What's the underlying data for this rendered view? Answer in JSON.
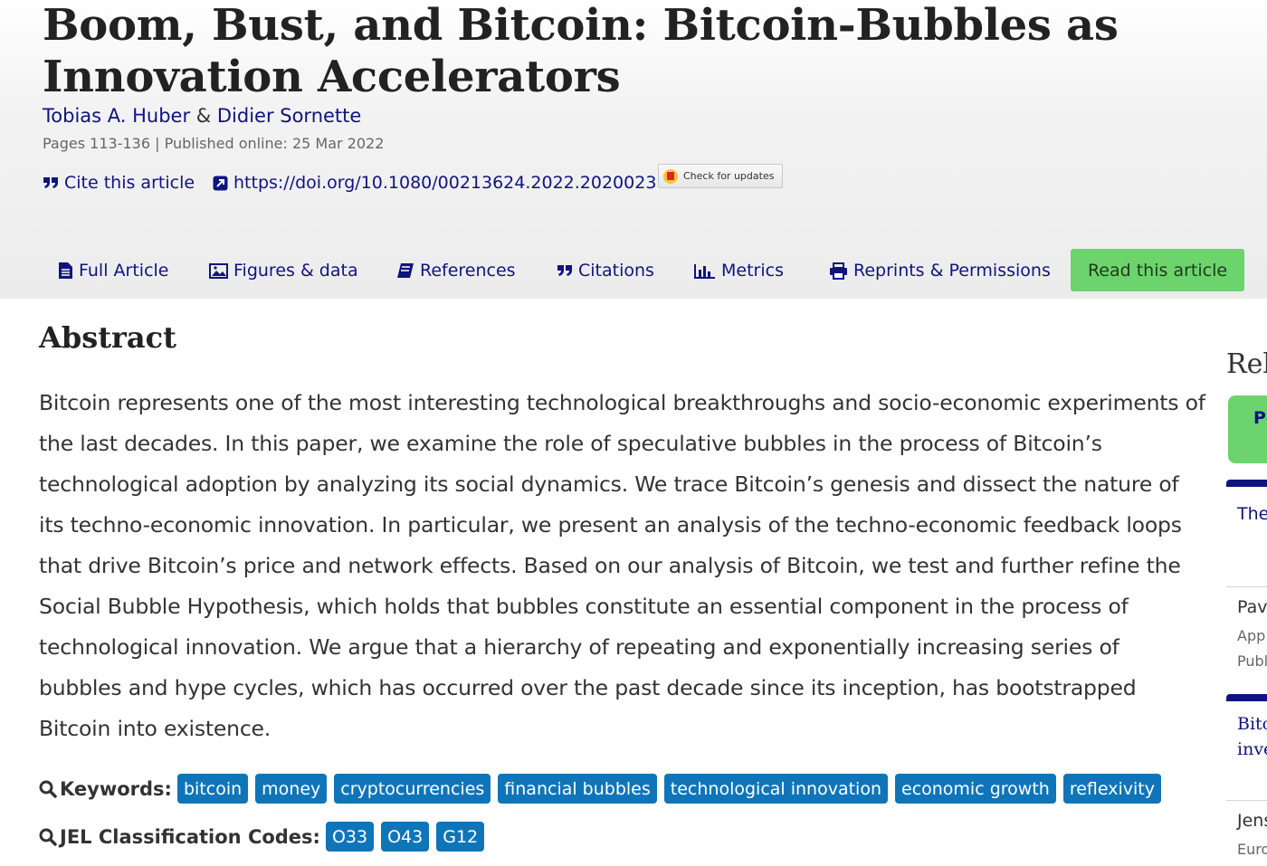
{
  "article": {
    "title": "Boom, Bust, and Bitcoin: Bitcoin-Bubbles as Innovation Accelerators",
    "authors": [
      "Tobias A. Huber",
      "Didier Sornette"
    ],
    "author_separator": "&",
    "meta": "Pages 113-136 | Published online: 25 Mar 2022",
    "cite_label": "Cite this article",
    "doi": "https://doi.org/10.1080/00213624.2022.2020023",
    "check_updates": "Check for updates"
  },
  "nav": {
    "tabs": [
      {
        "label": "Full Article",
        "icon": "document-icon"
      },
      {
        "label": "Figures & data",
        "icon": "image-icon"
      },
      {
        "label": "References",
        "icon": "book-icon"
      },
      {
        "label": "Citations",
        "icon": "quote-icon"
      },
      {
        "label": "Metrics",
        "icon": "bar-chart-icon"
      },
      {
        "label": "Reprints & Permissions",
        "icon": "printer-icon"
      }
    ],
    "read_button": "Read this article"
  },
  "abstract": {
    "heading": "Abstract",
    "text": "Bitcoin represents one of the most interesting technological breakthroughs and socio-economic experiments of the last decades. In this paper, we examine the role of speculative bubbles in the process of Bitcoin’s technological adoption by analyzing its social dynamics. We trace Bitcoin’s genesis and dissect the nature of its techno-economic innovation. In particular, we present an analysis of the techno-economic feedback loops that drive Bitcoin’s price and network effects. Based on our analysis of Bitcoin, we test and further refine the Social Bubble Hypothesis, which holds that bubbles constitute an essential component in the process of technological innovation. We argue that a hierarchy of repeating and exponentially increasing series of bubbles and hype cycles, which has occurred over the past decade since its inception, has bootstrapped Bitcoin into existence."
  },
  "keywords": {
    "label": "Keywords:",
    "items": [
      "bitcoin",
      "money",
      "cryptocurrencies",
      "financial bubbles",
      "technological innovation",
      "economic growth",
      "reflexivity"
    ]
  },
  "jel": {
    "label": "JEL Classification Codes:",
    "items": [
      "O33",
      "O43",
      "G12"
    ]
  },
  "sidebar": {
    "title": "Rel",
    "green_tab": "Pe",
    "item1_title": "The",
    "item2_author": "Pav",
    "item2_line2": "App",
    "item2_line3": "Publ",
    "item3_line1": "Bitc",
    "item3_line2": "inve",
    "item4_author": "Jens",
    "item4_line2": "Euro"
  },
  "colors": {
    "link": "#10147e",
    "tag": "#1075b8",
    "button": "#6dd36d"
  }
}
